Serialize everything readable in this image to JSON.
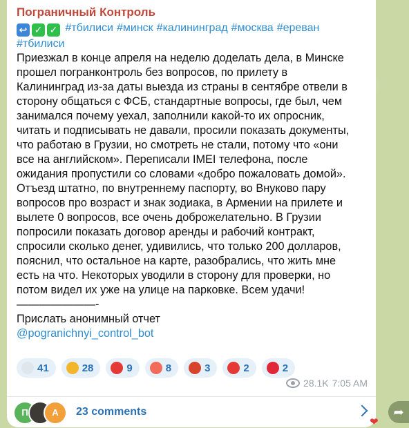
{
  "channel": {
    "name": "Пограничный Контроль"
  },
  "post": {
    "tags_line1": [
      "#тбилиси",
      "#минск",
      "#калининград",
      "#москва",
      "#ереван"
    ],
    "tags_line2": [
      "#тбилиси"
    ],
    "body": [
      "Приезжал в конце апреля на неделю доделать дела, в Минске",
      "прошел погранконтроль без вопросов, по прилету в",
      "Калининград из-за даты выезда из страны в сентябре отвели в",
      "сторону общаться с ФСБ, стандартные вопросы, где был, чем",
      "занимался почему уехал, заполнили какой-то их опросник,",
      "читать и подписывать не давали, просили показать документы,",
      "что работаю в Грузии, но смотреть не стали, потому что «они",
      "все на английском». Переписали IMEI телефона, после",
      "ожидания пропустили со словами «добро пожаловать домой».",
      "Отъезд штатно, по внутреннему паспорту, во Внуково пару",
      "вопросов про возраст и знак зодиака, в Армении на прилете и",
      "вылете 0 вопросов, все очень доброжелательно. В Грузии",
      "попросили показать договор аренды и рабочий контракт,",
      "спросили сколько денег, удивились, что только 200 долларов,",
      "пояснил, что остальное на карте, разобрались, что жить мне",
      "есть на что. Некоторых уводили в сторону для проверки, но",
      "потом видел их уже на улице на парковке. Всем удачи!",
      "———————-",
      "Прислать анонимный отчет"
    ],
    "bot_link": "@pogranichnyi_control_bot"
  },
  "reactions": [
    {
      "icon": "dove-icon",
      "count": "41",
      "color": "#dfe6ec"
    },
    {
      "icon": "thumbs-up-icon",
      "count": "28",
      "color": "#f3b62b"
    },
    {
      "icon": "heart-icon",
      "count": "9",
      "color": "#e53935"
    },
    {
      "icon": "clown-face-icon",
      "count": "8",
      "color": "#f26b5b"
    },
    {
      "icon": "cursing-face-icon",
      "count": "3",
      "color": "#d8432b"
    },
    {
      "icon": "hundred-icon",
      "count": "2",
      "color": "#e53935"
    },
    {
      "icon": "strawberry-icon",
      "count": "2",
      "color": "#e0283a"
    }
  ],
  "meta": {
    "views": "28.1K",
    "time": "7:05 AM"
  },
  "comments": {
    "label": "23 comments",
    "avatars": [
      {
        "letter": "П",
        "color": "#59b35a"
      },
      {
        "letter": "",
        "color": "#3d3a36"
      },
      {
        "letter": "А",
        "color": "#f2a13a"
      }
    ]
  },
  "side": {
    "share_icon": "share-arrow-icon",
    "heart": "❤"
  }
}
